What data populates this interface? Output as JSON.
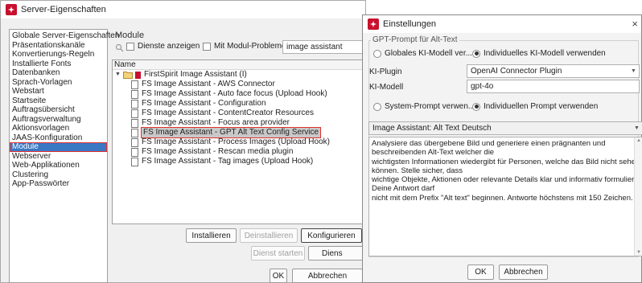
{
  "server_window": {
    "title": "Server-Eigenschaften",
    "sidebar": {
      "items": [
        {
          "label": "Globale Server-Eigenschaften",
          "selected": false
        },
        {
          "label": "Präsentationskanäle",
          "selected": false
        },
        {
          "label": "Konvertierungs-Regeln",
          "selected": false
        },
        {
          "label": "Installierte Fonts",
          "selected": false
        },
        {
          "label": "Datenbanken",
          "selected": false
        },
        {
          "label": "Sprach-Vorlagen",
          "selected": false
        },
        {
          "label": "Webstart",
          "selected": false
        },
        {
          "label": "Startseite",
          "selected": false
        },
        {
          "label": "Auftragsübersicht",
          "selected": false
        },
        {
          "label": "Auftragsverwaltung",
          "selected": false
        },
        {
          "label": "Aktionsvorlagen",
          "selected": false
        },
        {
          "label": "JAAS-Konfiguration",
          "selected": false
        },
        {
          "label": "Module",
          "selected": true
        },
        {
          "label": "Webserver",
          "selected": false
        },
        {
          "label": "Web-Applikationen",
          "selected": false
        },
        {
          "label": "Clustering",
          "selected": false
        },
        {
          "label": "App-Passwörter",
          "selected": false
        }
      ]
    },
    "modules": {
      "group_title": "Module",
      "show_services_label": "Dienste anzeigen",
      "module_problems_label": "Mit Modul-Problemen",
      "filter_value": "image assistant",
      "column_name": "Name",
      "root_label": "FirstSpirit Image Assistant (I)",
      "children": [
        {
          "label": "FS Image Assistant - AWS Connector",
          "selected": false
        },
        {
          "label": "FS Image Assistant - Auto face focus (Upload Hook)",
          "selected": false
        },
        {
          "label": "FS Image Assistant - Configuration",
          "selected": false
        },
        {
          "label": "FS Image Assistant - ContentCreator Resources",
          "selected": false
        },
        {
          "label": "FS Image Assistant - Focus area provider",
          "selected": false
        },
        {
          "label": "FS Image Assistant - GPT Alt Text Config Service",
          "selected": true
        },
        {
          "label": "FS Image Assistant - Process Images (Upload Hook)",
          "selected": false
        },
        {
          "label": "FS Image Assistant - Rescan media plugin",
          "selected": false
        },
        {
          "label": "FS Image Assistant - Tag images (Upload Hook)",
          "selected": false
        }
      ],
      "buttons": {
        "install": "Installieren",
        "uninstall": "Deinstallieren",
        "configure": "Konfigurieren",
        "start_service": "Dienst starten",
        "stop_service_partial": "Diens"
      }
    },
    "footer": {
      "ok": "OK",
      "cancel": "Abbrechen"
    }
  },
  "settings_dialog": {
    "title": "Einstellungen",
    "close_glyph": "×",
    "group_title": "GPT-Prompt für Alt-Text",
    "model_mode": {
      "option_global": "Globales KI-Modell ver...",
      "option_individual": "Individuelles KI-Modell verwenden",
      "selected": "individual"
    },
    "plugin_label": "KI-Plugin",
    "plugin_value": "OpenAI Connector Plugin",
    "model_label": "KI-Modell",
    "model_value": "gpt-4o",
    "prompt_mode": {
      "option_system": "System-Prompt verwen...",
      "option_individual": "Individuellen Prompt verwenden",
      "selected": "individual"
    },
    "prompt_select_value": "Image Assistant: Alt Text Deutsch",
    "prompt_lines": [
      "Analysiere das übergebene Bild und generiere einen prägnanten und",
      "beschreibenden Alt-Text welcher die",
      "wichtigsten Informationen wiedergibt für Personen, welche das Bild nicht sehen",
      "können. Stelle sicher, dass",
      "wichtige Objekte, Aktionen oder relevante Details klar und informativ formuliert sind.",
      "Deine Antwort darf",
      "nicht mit dem Prefix \"Alt text\" beginnen. Antworte höchstens mit 150 Zeichen."
    ],
    "ok": "OK",
    "cancel": "Abbrechen"
  },
  "colors": {
    "app_icon": "#c8102e",
    "selection": "#3a78c3",
    "highlight_border": "#e03030"
  }
}
